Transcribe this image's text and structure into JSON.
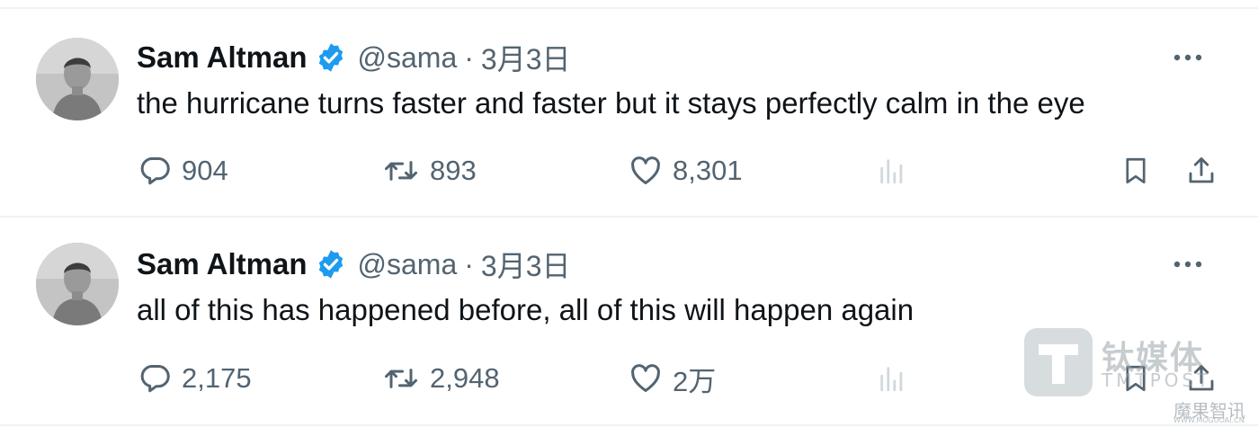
{
  "tweets": [
    {
      "name": "Sam Altman",
      "handle": "@sama",
      "separator": "·",
      "date": "3月3日",
      "text": "the hurricane turns faster and faster but it stays perfectly calm in the eye",
      "replies": "904",
      "retweets": "893",
      "likes": "8,301"
    },
    {
      "name": "Sam Altman",
      "handle": "@sama",
      "separator": "·",
      "date": "3月3日",
      "text": "all of this has happened before, all of this will happen again",
      "replies": "2,175",
      "retweets": "2,948",
      "likes": "2万"
    }
  ],
  "icons": {
    "verified": "verified-badge-icon",
    "more": "more-options-icon",
    "reply": "reply-icon",
    "retweet": "retweet-icon",
    "like": "heart-icon",
    "views": "views-icon",
    "bookmark": "bookmark-icon",
    "share": "share-icon"
  },
  "watermark": {
    "brand_cn": "钛媒体",
    "brand_en": "TMTPOST",
    "corner_text": "魔果智讯",
    "corner_url": "WWW.MOGUOAI.CN"
  },
  "colors": {
    "text_primary": "#0f1419",
    "text_secondary": "#536471",
    "verified_blue": "#1d9bf0",
    "divider": "#eff3f4"
  }
}
